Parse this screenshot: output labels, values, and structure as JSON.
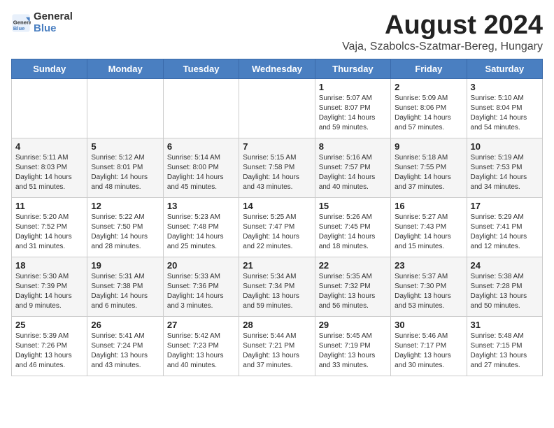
{
  "logo": {
    "line1": "General",
    "line2": "Blue"
  },
  "title": "August 2024",
  "subtitle": "Vaja, Szabolcs-Szatmar-Bereg, Hungary",
  "days_of_week": [
    "Sunday",
    "Monday",
    "Tuesday",
    "Wednesday",
    "Thursday",
    "Friday",
    "Saturday"
  ],
  "weeks": [
    [
      {
        "num": "",
        "info": ""
      },
      {
        "num": "",
        "info": ""
      },
      {
        "num": "",
        "info": ""
      },
      {
        "num": "",
        "info": ""
      },
      {
        "num": "1",
        "info": "Sunrise: 5:07 AM\nSunset: 8:07 PM\nDaylight: 14 hours\nand 59 minutes."
      },
      {
        "num": "2",
        "info": "Sunrise: 5:09 AM\nSunset: 8:06 PM\nDaylight: 14 hours\nand 57 minutes."
      },
      {
        "num": "3",
        "info": "Sunrise: 5:10 AM\nSunset: 8:04 PM\nDaylight: 14 hours\nand 54 minutes."
      }
    ],
    [
      {
        "num": "4",
        "info": "Sunrise: 5:11 AM\nSunset: 8:03 PM\nDaylight: 14 hours\nand 51 minutes."
      },
      {
        "num": "5",
        "info": "Sunrise: 5:12 AM\nSunset: 8:01 PM\nDaylight: 14 hours\nand 48 minutes."
      },
      {
        "num": "6",
        "info": "Sunrise: 5:14 AM\nSunset: 8:00 PM\nDaylight: 14 hours\nand 45 minutes."
      },
      {
        "num": "7",
        "info": "Sunrise: 5:15 AM\nSunset: 7:58 PM\nDaylight: 14 hours\nand 43 minutes."
      },
      {
        "num": "8",
        "info": "Sunrise: 5:16 AM\nSunset: 7:57 PM\nDaylight: 14 hours\nand 40 minutes."
      },
      {
        "num": "9",
        "info": "Sunrise: 5:18 AM\nSunset: 7:55 PM\nDaylight: 14 hours\nand 37 minutes."
      },
      {
        "num": "10",
        "info": "Sunrise: 5:19 AM\nSunset: 7:53 PM\nDaylight: 14 hours\nand 34 minutes."
      }
    ],
    [
      {
        "num": "11",
        "info": "Sunrise: 5:20 AM\nSunset: 7:52 PM\nDaylight: 14 hours\nand 31 minutes."
      },
      {
        "num": "12",
        "info": "Sunrise: 5:22 AM\nSunset: 7:50 PM\nDaylight: 14 hours\nand 28 minutes."
      },
      {
        "num": "13",
        "info": "Sunrise: 5:23 AM\nSunset: 7:48 PM\nDaylight: 14 hours\nand 25 minutes."
      },
      {
        "num": "14",
        "info": "Sunrise: 5:25 AM\nSunset: 7:47 PM\nDaylight: 14 hours\nand 22 minutes."
      },
      {
        "num": "15",
        "info": "Sunrise: 5:26 AM\nSunset: 7:45 PM\nDaylight: 14 hours\nand 18 minutes."
      },
      {
        "num": "16",
        "info": "Sunrise: 5:27 AM\nSunset: 7:43 PM\nDaylight: 14 hours\nand 15 minutes."
      },
      {
        "num": "17",
        "info": "Sunrise: 5:29 AM\nSunset: 7:41 PM\nDaylight: 14 hours\nand 12 minutes."
      }
    ],
    [
      {
        "num": "18",
        "info": "Sunrise: 5:30 AM\nSunset: 7:39 PM\nDaylight: 14 hours\nand 9 minutes."
      },
      {
        "num": "19",
        "info": "Sunrise: 5:31 AM\nSunset: 7:38 PM\nDaylight: 14 hours\nand 6 minutes."
      },
      {
        "num": "20",
        "info": "Sunrise: 5:33 AM\nSunset: 7:36 PM\nDaylight: 14 hours\nand 3 minutes."
      },
      {
        "num": "21",
        "info": "Sunrise: 5:34 AM\nSunset: 7:34 PM\nDaylight: 13 hours\nand 59 minutes."
      },
      {
        "num": "22",
        "info": "Sunrise: 5:35 AM\nSunset: 7:32 PM\nDaylight: 13 hours\nand 56 minutes."
      },
      {
        "num": "23",
        "info": "Sunrise: 5:37 AM\nSunset: 7:30 PM\nDaylight: 13 hours\nand 53 minutes."
      },
      {
        "num": "24",
        "info": "Sunrise: 5:38 AM\nSunset: 7:28 PM\nDaylight: 13 hours\nand 50 minutes."
      }
    ],
    [
      {
        "num": "25",
        "info": "Sunrise: 5:39 AM\nSunset: 7:26 PM\nDaylight: 13 hours\nand 46 minutes."
      },
      {
        "num": "26",
        "info": "Sunrise: 5:41 AM\nSunset: 7:24 PM\nDaylight: 13 hours\nand 43 minutes."
      },
      {
        "num": "27",
        "info": "Sunrise: 5:42 AM\nSunset: 7:23 PM\nDaylight: 13 hours\nand 40 minutes."
      },
      {
        "num": "28",
        "info": "Sunrise: 5:44 AM\nSunset: 7:21 PM\nDaylight: 13 hours\nand 37 minutes."
      },
      {
        "num": "29",
        "info": "Sunrise: 5:45 AM\nSunset: 7:19 PM\nDaylight: 13 hours\nand 33 minutes."
      },
      {
        "num": "30",
        "info": "Sunrise: 5:46 AM\nSunset: 7:17 PM\nDaylight: 13 hours\nand 30 minutes."
      },
      {
        "num": "31",
        "info": "Sunrise: 5:48 AM\nSunset: 7:15 PM\nDaylight: 13 hours\nand 27 minutes."
      }
    ]
  ]
}
